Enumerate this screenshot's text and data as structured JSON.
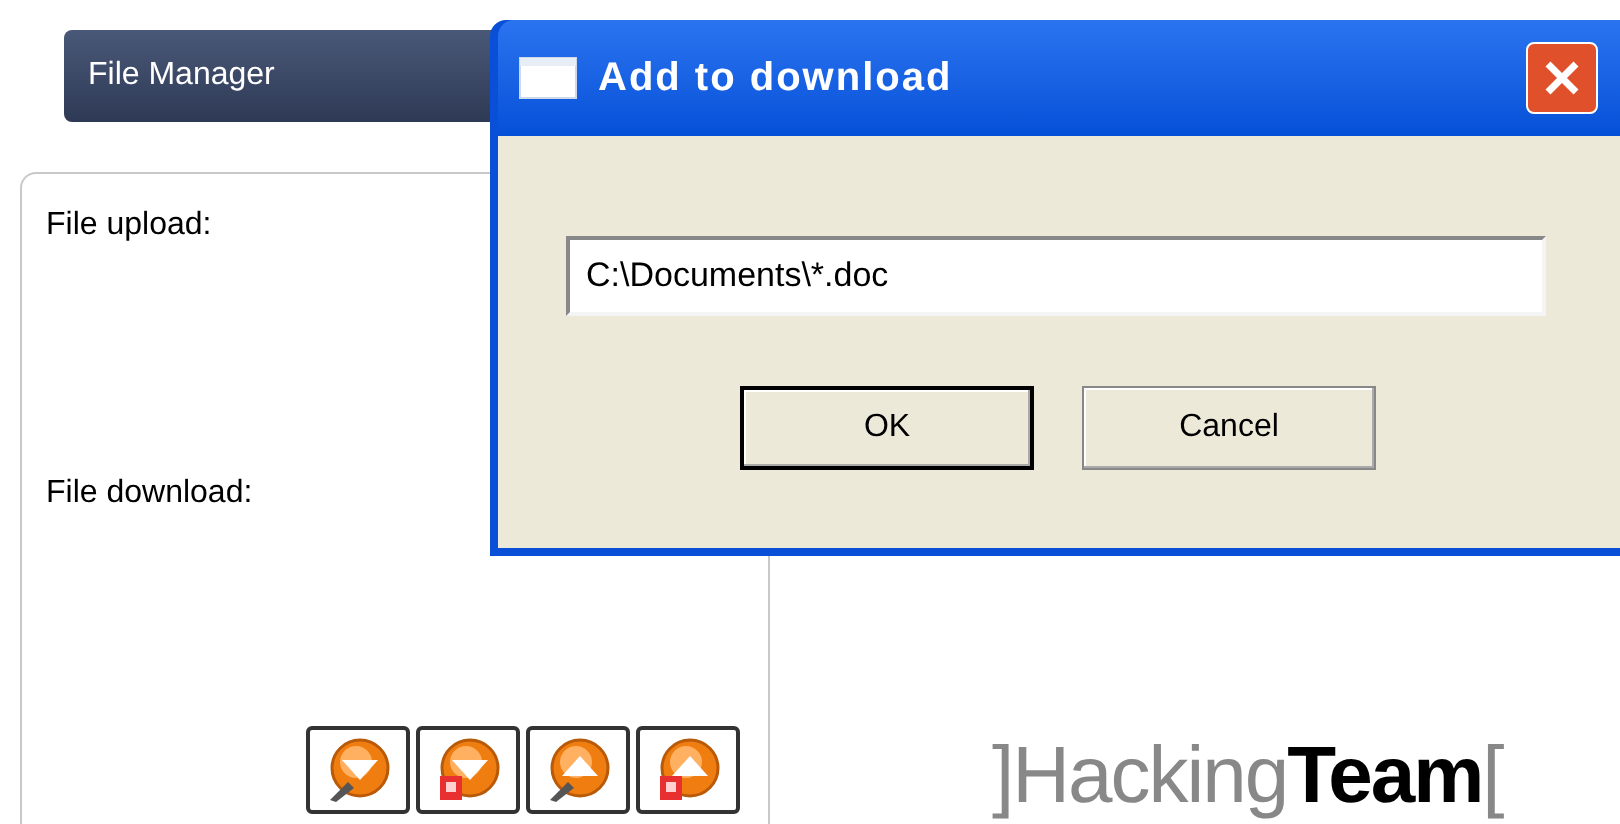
{
  "header": {
    "title": "File Manager"
  },
  "panel": {
    "upload_label": "File upload:",
    "download_label": "File download:"
  },
  "tool_buttons": [
    {
      "kind": "pendown"
    },
    {
      "kind": "filedown"
    },
    {
      "kind": "penup"
    },
    {
      "kind": "fileup"
    }
  ],
  "logo": "]Hacking**Team**[",
  "dialog": {
    "title": "Add to download",
    "path": "C:\\Documents\\*.doc",
    "buttons": [
      {
        "label": "OK",
        "default": true
      },
      {
        "label": "Cancel",
        "default": false
      }
    ]
  }
}
